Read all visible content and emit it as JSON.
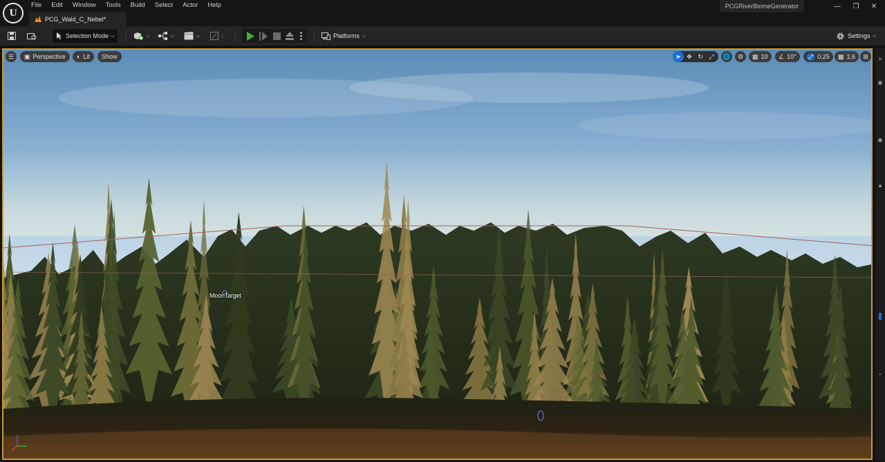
{
  "app": {
    "menu": [
      "File",
      "Edit",
      "Window",
      "Tools",
      "Build",
      "Select",
      "Actor",
      "Help"
    ],
    "document_tab": "PCG_Wald_C_Nebel*",
    "project_name": "PCGRiverBiomeGenerator"
  },
  "toolbar": {
    "selection_mode": "Selection Mode",
    "platforms": "Platforms",
    "settings": "Settings"
  },
  "viewport": {
    "perspective": "Perspective",
    "lit": "Lit",
    "show": "Show",
    "grid_snap": "10",
    "rotation_snap": "10°",
    "scale_snap": "0,25",
    "camera_speed": "1,6",
    "actor_label": "MoonTarget"
  },
  "colors": {
    "accent": "#1d6fd6",
    "viewport_border": "#c99a2e",
    "play_green": "#3fae3f",
    "tab_icon_orange": "#e38b1c"
  },
  "icons": {
    "save": "save-icon",
    "content_browser": "content-browser-icon",
    "add_actor": "add-actor-icon",
    "blueprints": "blueprint-icon",
    "cinematics": "clapperboard-icon",
    "play": "play-icon",
    "step": "step-icon",
    "stop": "stop-icon",
    "eject": "eject-icon",
    "settings": "gear-icon"
  }
}
